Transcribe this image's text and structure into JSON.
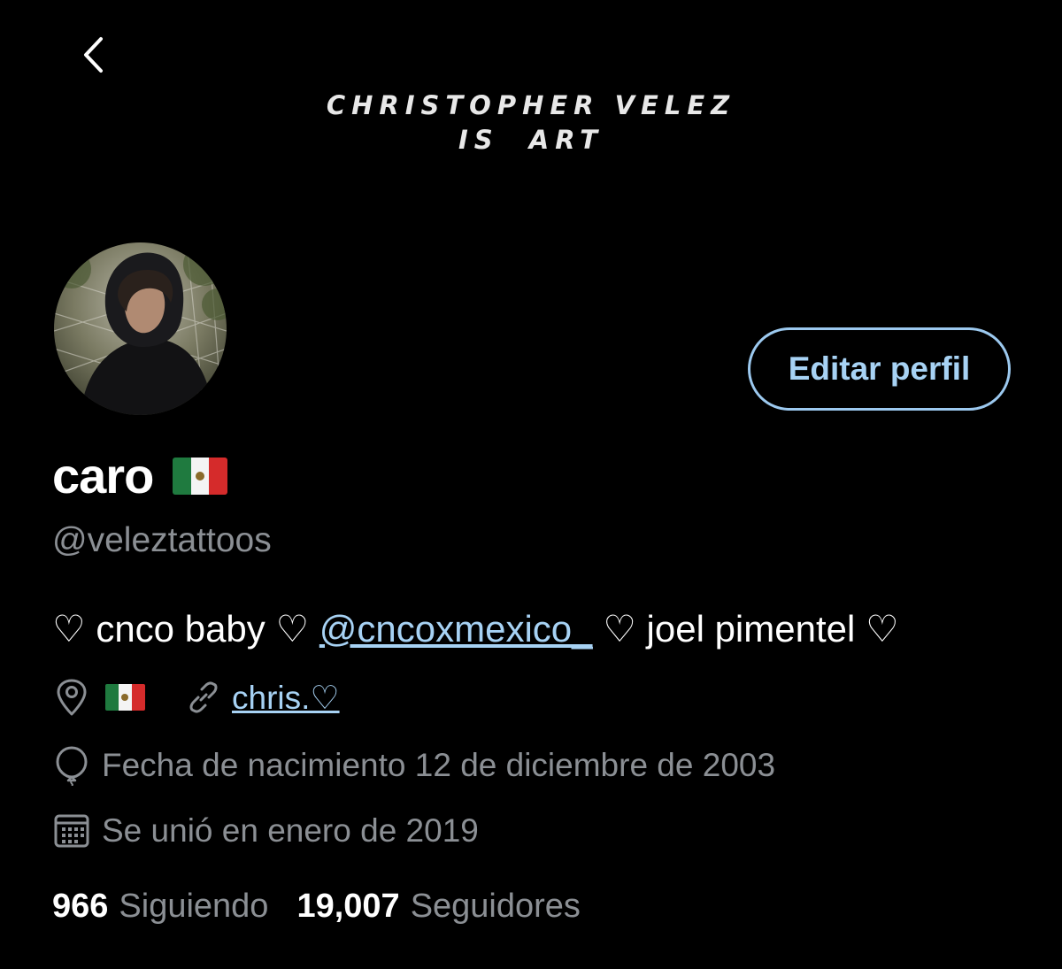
{
  "header": {
    "back_icon": "chevron-left-icon"
  },
  "banner": {
    "line1": "CHRISTOPHER VELEZ",
    "line2": "IS  ART"
  },
  "profile": {
    "avatar_icon": "profile-photo",
    "edit_label": "Editar perfil",
    "display_name": "caro",
    "handle": "@veleztattoos"
  },
  "bio": {
    "part1": "♡ cnco baby ♡ ",
    "mention": "@cncoxmexico_",
    "part2": " ♡ joel pimentel ♡"
  },
  "meta": {
    "location_icon": "location-pin-icon",
    "location_flag": "mexico-flag",
    "link_icon": "link-icon",
    "website": "chris.♡",
    "birthday_icon": "balloon-icon",
    "birthday": "Fecha de nacimiento 12 de diciembre de 2003",
    "joined_icon": "calendar-icon",
    "joined": "Se unió en enero de 2019"
  },
  "stats": {
    "following_count": "966",
    "following_label": "Siguiendo",
    "followers_count": "19,007",
    "followers_label": "Seguidores"
  },
  "colors": {
    "accent": "#a7d2f4",
    "muted": "#8b8f94",
    "background": "#000000"
  }
}
